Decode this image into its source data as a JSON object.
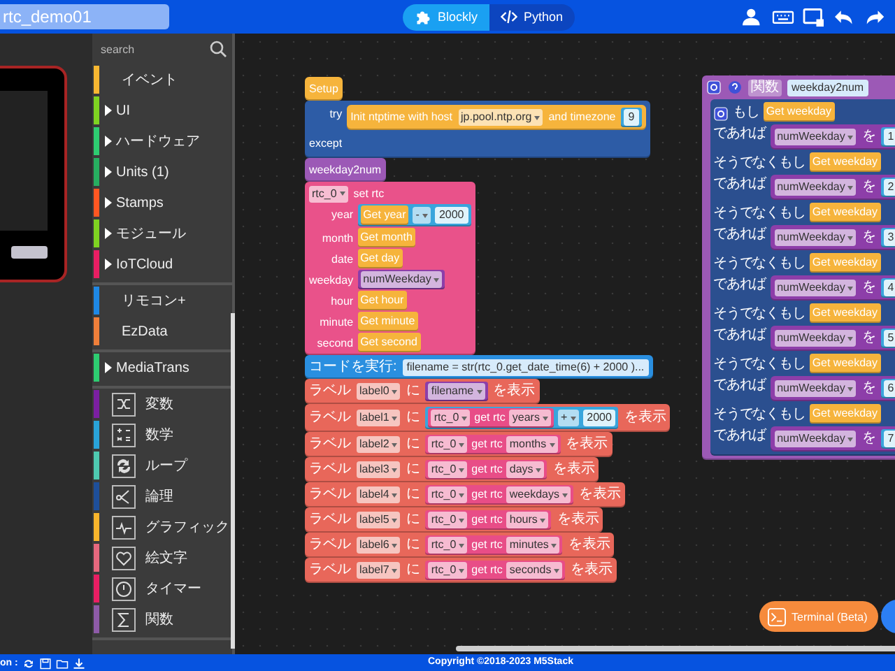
{
  "header": {
    "project_name": "rtc_demo01",
    "tabs": [
      {
        "label": "Blockly",
        "selected": true
      },
      {
        "label": "Python",
        "selected": false
      }
    ]
  },
  "toolbox": {
    "search": {
      "placeholder": "search"
    },
    "groups": [
      {
        "items": [
          {
            "label": "イベント",
            "color": "#f7b731",
            "kind": "plain"
          },
          {
            "label": "UI",
            "color": "#7ed321",
            "kind": "folder"
          },
          {
            "label": "ハードウェア",
            "color": "#2ecc71",
            "kind": "folder"
          },
          {
            "label": "Units (1)",
            "color": "#27ae60",
            "kind": "folder"
          },
          {
            "label": "Stamps",
            "color": "#ff5722",
            "kind": "folder"
          },
          {
            "label": "モジュール",
            "color": "#7ed321",
            "kind": "folder"
          },
          {
            "label": "IoTCloud",
            "color": "#e91e63",
            "kind": "folder"
          }
        ]
      },
      {
        "items": [
          {
            "label": "リモコン+",
            "color": "#1e88e5",
            "kind": "plain"
          },
          {
            "label": "EzData",
            "color": "#ef7f3a",
            "kind": "plain"
          }
        ]
      },
      {
        "items": [
          {
            "label": "MediaTrans",
            "color": "#2ecc71",
            "kind": "folder"
          }
        ]
      },
      {
        "items": [
          {
            "label": "変数",
            "color": "#7b1fa2",
            "kind": "icon"
          },
          {
            "label": "数学",
            "color": "#29a3d9",
            "kind": "icon"
          },
          {
            "label": "ループ",
            "color": "#4ec9b0",
            "kind": "icon"
          },
          {
            "label": "論理",
            "color": "#1e4f9a",
            "kind": "icon"
          },
          {
            "label": "グラフィック",
            "color": "#f9b52c",
            "kind": "icon"
          },
          {
            "label": "絵文字",
            "color": "#e6687e",
            "kind": "icon"
          },
          {
            "label": "タイマー",
            "color": "#e91e63",
            "kind": "icon"
          },
          {
            "label": "関数",
            "color": "#8e5ba8",
            "kind": "icon"
          }
        ]
      }
    ]
  },
  "workspace": {
    "stacks": [
      {
        "blocks": [
          {
            "kind": "statement",
            "color": "#f6b43c",
            "rows": [
              {
                "parts": [
                  {
                    "kind": "text",
                    "text": "Setup"
                  }
                ]
              }
            ]
          },
          {
            "kind": "statement",
            "color": "#2d5ca6",
            "rows": [
              {
                "label": "try",
                "body": [
                  {
                    "kind": "statement",
                    "color": "#f6b43c",
                    "rows": [
                      {
                        "parts": [
                          {
                            "kind": "text",
                            "text": "Init ntptime with host"
                          },
                          {
                            "kind": "dropdown",
                            "text": "jp.pool.ntp.org"
                          },
                          {
                            "kind": "text",
                            "text": "and timezone"
                          },
                          {
                            "kind": "value",
                            "color": "#39a5dc",
                            "parts": [
                              {
                                "kind": "number",
                                "text": "9"
                              }
                            ]
                          }
                        ]
                      }
                    ]
                  }
                ]
              },
              {
                "label": "except",
                "body": []
              }
            ]
          },
          {
            "kind": "statement",
            "color": "#9c59b6",
            "rows": [
              {
                "parts": [
                  {
                    "kind": "text",
                    "text": "weekday2num"
                  }
                ]
              }
            ]
          },
          {
            "kind": "statement",
            "color": "#e9528a",
            "rows": [
              {
                "parts": [
                  {
                    "kind": "dropdown",
                    "text": "rtc_0"
                  },
                  {
                    "kind": "text",
                    "text": "set rtc"
                  }
                ]
              },
              {
                "label": "year",
                "parts": [
                  {
                    "kind": "value",
                    "color": "#39a5dc",
                    "parts": [
                      {
                        "kind": "value",
                        "color": "#f6b43c",
                        "parts": [
                          {
                            "kind": "text",
                            "text": "Get year"
                          }
                        ]
                      },
                      {
                        "kind": "dropdown",
                        "text": "-"
                      },
                      {
                        "kind": "number",
                        "text": "2000"
                      }
                    ]
                  }
                ]
              },
              {
                "label": "month",
                "parts": [
                  {
                    "kind": "value",
                    "color": "#f6b43c",
                    "parts": [
                      {
                        "kind": "text",
                        "text": "Get month"
                      }
                    ]
                  }
                ]
              },
              {
                "label": "date",
                "parts": [
                  {
                    "kind": "value",
                    "color": "#f6b43c",
                    "parts": [
                      {
                        "kind": "text",
                        "text": "Get day"
                      }
                    ]
                  }
                ]
              },
              {
                "label": "weekday",
                "parts": [
                  {
                    "kind": "value",
                    "color": "#8d3ea9",
                    "parts": [
                      {
                        "kind": "dropdown",
                        "text": "numWeekday"
                      }
                    ]
                  }
                ]
              },
              {
                "label": "hour",
                "parts": [
                  {
                    "kind": "value",
                    "color": "#f6b43c",
                    "parts": [
                      {
                        "kind": "text",
                        "text": "Get hour"
                      }
                    ]
                  }
                ]
              },
              {
                "label": "minute",
                "parts": [
                  {
                    "kind": "value",
                    "color": "#f6b43c",
                    "parts": [
                      {
                        "kind": "text",
                        "text": "Get minute"
                      }
                    ]
                  }
                ]
              },
              {
                "label": "second",
                "parts": [
                  {
                    "kind": "value",
                    "color": "#f6b43c",
                    "parts": [
                      {
                        "kind": "text",
                        "text": "Get second"
                      }
                    ]
                  }
                ]
              }
            ]
          },
          {
            "kind": "statement",
            "color": "#2a8fe0",
            "rows": [
              {
                "parts": [
                  {
                    "kind": "text",
                    "text": "コードを実行:"
                  },
                  {
                    "kind": "code",
                    "text": "filename = str(rtc_0.get_date_time(6) + 2000 )..."
                  }
                ]
              }
            ]
          },
          {
            "kind": "statement",
            "color": "#e8675a",
            "rows": [
              {
                "parts": [
                  {
                    "kind": "text",
                    "text": "ラベル"
                  },
                  {
                    "kind": "dropdown",
                    "text": "label0"
                  },
                  {
                    "kind": "text",
                    "text": "に"
                  },
                  {
                    "kind": "value",
                    "color": "#8d3ea9",
                    "parts": [
                      {
                        "kind": "dropdown",
                        "text": "filename"
                      }
                    ]
                  },
                  {
                    "kind": "text",
                    "text": "を表示"
                  }
                ]
              }
            ]
          },
          {
            "kind": "statement",
            "color": "#e8675a",
            "rows": [
              {
                "parts": [
                  {
                    "kind": "text",
                    "text": "ラベル"
                  },
                  {
                    "kind": "dropdown",
                    "text": "label1"
                  },
                  {
                    "kind": "text",
                    "text": "に"
                  },
                  {
                    "kind": "value",
                    "color": "#39a5dc",
                    "parts": [
                      {
                        "kind": "value",
                        "color": "#e84d87",
                        "parts": [
                          {
                            "kind": "dropdown",
                            "text": "rtc_0"
                          },
                          {
                            "kind": "text",
                            "text": "get rtc"
                          },
                          {
                            "kind": "dropdown",
                            "text": "years"
                          }
                        ]
                      },
                      {
                        "kind": "dropdown",
                        "text": "+"
                      },
                      {
                        "kind": "number",
                        "text": "2000"
                      }
                    ]
                  },
                  {
                    "kind": "text",
                    "text": "を表示"
                  }
                ]
              }
            ]
          },
          {
            "kind": "statement",
            "color": "#e8675a",
            "rows": [
              {
                "parts": [
                  {
                    "kind": "text",
                    "text": "ラベル"
                  },
                  {
                    "kind": "dropdown",
                    "text": "label2"
                  },
                  {
                    "kind": "text",
                    "text": "に"
                  },
                  {
                    "kind": "value",
                    "color": "#e84d87",
                    "parts": [
                      {
                        "kind": "dropdown",
                        "text": "rtc_0"
                      },
                      {
                        "kind": "text",
                        "text": "get rtc"
                      },
                      {
                        "kind": "dropdown",
                        "text": "months"
                      }
                    ]
                  },
                  {
                    "kind": "text",
                    "text": "を表示"
                  }
                ]
              }
            ]
          },
          {
            "kind": "statement",
            "color": "#e8675a",
            "rows": [
              {
                "parts": [
                  {
                    "kind": "text",
                    "text": "ラベル"
                  },
                  {
                    "kind": "dropdown",
                    "text": "label3"
                  },
                  {
                    "kind": "text",
                    "text": "に"
                  },
                  {
                    "kind": "value",
                    "color": "#e84d87",
                    "parts": [
                      {
                        "kind": "dropdown",
                        "text": "rtc_0"
                      },
                      {
                        "kind": "text",
                        "text": "get rtc"
                      },
                      {
                        "kind": "dropdown",
                        "text": "days"
                      }
                    ]
                  },
                  {
                    "kind": "text",
                    "text": "を表示"
                  }
                ]
              }
            ]
          },
          {
            "kind": "statement",
            "color": "#e8675a",
            "rows": [
              {
                "parts": [
                  {
                    "kind": "text",
                    "text": "ラベル"
                  },
                  {
                    "kind": "dropdown",
                    "text": "label4"
                  },
                  {
                    "kind": "text",
                    "text": "に"
                  },
                  {
                    "kind": "value",
                    "color": "#e84d87",
                    "parts": [
                      {
                        "kind": "dropdown",
                        "text": "rtc_0"
                      },
                      {
                        "kind": "text",
                        "text": "get rtc"
                      },
                      {
                        "kind": "dropdown",
                        "text": "weekdays"
                      }
                    ]
                  },
                  {
                    "kind": "text",
                    "text": "を表示"
                  }
                ]
              }
            ]
          },
          {
            "kind": "statement",
            "color": "#e8675a",
            "rows": [
              {
                "parts": [
                  {
                    "kind": "text",
                    "text": "ラベル"
                  },
                  {
                    "kind": "dropdown",
                    "text": "label5"
                  },
                  {
                    "kind": "text",
                    "text": "に"
                  },
                  {
                    "kind": "value",
                    "color": "#e84d87",
                    "parts": [
                      {
                        "kind": "dropdown",
                        "text": "rtc_0"
                      },
                      {
                        "kind": "text",
                        "text": "get rtc"
                      },
                      {
                        "kind": "dropdown",
                        "text": "hours"
                      }
                    ]
                  },
                  {
                    "kind": "text",
                    "text": "を表示"
                  }
                ]
              }
            ]
          },
          {
            "kind": "statement",
            "color": "#e8675a",
            "rows": [
              {
                "parts": [
                  {
                    "kind": "text",
                    "text": "ラベル"
                  },
                  {
                    "kind": "dropdown",
                    "text": "label6"
                  },
                  {
                    "kind": "text",
                    "text": "に"
                  },
                  {
                    "kind": "value",
                    "color": "#e84d87",
                    "parts": [
                      {
                        "kind": "dropdown",
                        "text": "rtc_0"
                      },
                      {
                        "kind": "text",
                        "text": "get rtc"
                      },
                      {
                        "kind": "dropdown",
                        "text": "minutes"
                      }
                    ]
                  },
                  {
                    "kind": "text",
                    "text": "を表示"
                  }
                ]
              }
            ]
          },
          {
            "kind": "statement",
            "color": "#e8675a",
            "rows": [
              {
                "parts": [
                  {
                    "kind": "text",
                    "text": "ラベル"
                  },
                  {
                    "kind": "dropdown",
                    "text": "label7"
                  },
                  {
                    "kind": "text",
                    "text": "に"
                  },
                  {
                    "kind": "value",
                    "color": "#e84d87",
                    "parts": [
                      {
                        "kind": "dropdown",
                        "text": "rtc_0"
                      },
                      {
                        "kind": "text",
                        "text": "get rtc"
                      },
                      {
                        "kind": "dropdown",
                        "text": "seconds"
                      }
                    ]
                  },
                  {
                    "kind": "text",
                    "text": "を表示"
                  }
                ]
              }
            ]
          }
        ]
      },
      {
        "blocks": [
          {
            "kind": "function",
            "color": "#9c59b6",
            "rows": [
              {
                "parts": [
                  {
                    "kind": "tag",
                    "text": "関数"
                  },
                  {
                    "kind": "code",
                    "text": "weekday2num"
                  }
                ]
              },
              {
                "body": [
                  {
                    "kind": "if",
                    "color": "#2b4f8f",
                    "rows": [
                      {
                        "label": "もし",
                        "parts": [
                          {
                            "kind": "value",
                            "color": "#f6b43c",
                            "parts": [
                              {
                                "kind": "text",
                                "text": "Get weekday"
                              }
                            ]
                          }
                        ]
                      },
                      {
                        "label": "であれば",
                        "body": [
                          {
                            "kind": "statement",
                            "color": "#8d3ea9",
                            "rows": [
                              {
                                "parts": [
                                  {
                                    "kind": "dropdown",
                                    "text": "numWeekday"
                                  },
                                  {
                                    "kind": "text",
                                    "text": "を"
                                  },
                                  {
                                    "kind": "value",
                                    "color": "#39a5dc",
                                    "parts": [
                                      {
                                        "kind": "number",
                                        "text": "1"
                                      }
                                    ]
                                  }
                                ]
                              }
                            ]
                          }
                        ]
                      },
                      {
                        "label": "そうでなくもし",
                        "parts": [
                          {
                            "kind": "value",
                            "color": "#f6b43c",
                            "parts": [
                              {
                                "kind": "text",
                                "text": "Get weekday"
                              }
                            ]
                          }
                        ]
                      },
                      {
                        "label": "であれば",
                        "body": [
                          {
                            "kind": "statement",
                            "color": "#8d3ea9",
                            "rows": [
                              {
                                "parts": [
                                  {
                                    "kind": "dropdown",
                                    "text": "numWeekday"
                                  },
                                  {
                                    "kind": "text",
                                    "text": "を"
                                  },
                                  {
                                    "kind": "value",
                                    "color": "#39a5dc",
                                    "parts": [
                                      {
                                        "kind": "number",
                                        "text": "2"
                                      }
                                    ]
                                  }
                                ]
                              }
                            ]
                          }
                        ]
                      },
                      {
                        "label": "そうでなくもし",
                        "parts": [
                          {
                            "kind": "value",
                            "color": "#f6b43c",
                            "parts": [
                              {
                                "kind": "text",
                                "text": "Get weekday"
                              }
                            ]
                          }
                        ]
                      },
                      {
                        "label": "であれば",
                        "body": [
                          {
                            "kind": "statement",
                            "color": "#8d3ea9",
                            "rows": [
                              {
                                "parts": [
                                  {
                                    "kind": "dropdown",
                                    "text": "numWeekday"
                                  },
                                  {
                                    "kind": "text",
                                    "text": "を"
                                  },
                                  {
                                    "kind": "value",
                                    "color": "#39a5dc",
                                    "parts": [
                                      {
                                        "kind": "number",
                                        "text": "3"
                                      }
                                    ]
                                  }
                                ]
                              }
                            ]
                          }
                        ]
                      },
                      {
                        "label": "そうでなくもし",
                        "parts": [
                          {
                            "kind": "value",
                            "color": "#f6b43c",
                            "parts": [
                              {
                                "kind": "text",
                                "text": "Get weekday"
                              }
                            ]
                          }
                        ]
                      },
                      {
                        "label": "であれば",
                        "body": [
                          {
                            "kind": "statement",
                            "color": "#8d3ea9",
                            "rows": [
                              {
                                "parts": [
                                  {
                                    "kind": "dropdown",
                                    "text": "numWeekday"
                                  },
                                  {
                                    "kind": "text",
                                    "text": "を"
                                  },
                                  {
                                    "kind": "value",
                                    "color": "#39a5dc",
                                    "parts": [
                                      {
                                        "kind": "number",
                                        "text": "4"
                                      }
                                    ]
                                  }
                                ]
                              }
                            ]
                          }
                        ]
                      },
                      {
                        "label": "そうでなくもし",
                        "parts": [
                          {
                            "kind": "value",
                            "color": "#f6b43c",
                            "parts": [
                              {
                                "kind": "text",
                                "text": "Get weekday"
                              }
                            ]
                          }
                        ]
                      },
                      {
                        "label": "であれば",
                        "body": [
                          {
                            "kind": "statement",
                            "color": "#8d3ea9",
                            "rows": [
                              {
                                "parts": [
                                  {
                                    "kind": "dropdown",
                                    "text": "numWeekday"
                                  },
                                  {
                                    "kind": "text",
                                    "text": "を"
                                  },
                                  {
                                    "kind": "value",
                                    "color": "#39a5dc",
                                    "parts": [
                                      {
                                        "kind": "number",
                                        "text": "5"
                                      }
                                    ]
                                  }
                                ]
                              }
                            ]
                          }
                        ]
                      },
                      {
                        "label": "そうでなくもし",
                        "parts": [
                          {
                            "kind": "value",
                            "color": "#f6b43c",
                            "parts": [
                              {
                                "kind": "text",
                                "text": "Get weekday"
                              }
                            ]
                          }
                        ]
                      },
                      {
                        "label": "であれば",
                        "body": [
                          {
                            "kind": "statement",
                            "color": "#8d3ea9",
                            "rows": [
                              {
                                "parts": [
                                  {
                                    "kind": "dropdown",
                                    "text": "numWeekday"
                                  },
                                  {
                                    "kind": "text",
                                    "text": "を"
                                  },
                                  {
                                    "kind": "value",
                                    "color": "#39a5dc",
                                    "parts": [
                                      {
                                        "kind": "number",
                                        "text": "6"
                                      }
                                    ]
                                  }
                                ]
                              }
                            ]
                          }
                        ]
                      },
                      {
                        "label": "そうでなくもし",
                        "parts": [
                          {
                            "kind": "value",
                            "color": "#f6b43c",
                            "parts": [
                              {
                                "kind": "text",
                                "text": "Get weekday"
                              }
                            ]
                          }
                        ]
                      },
                      {
                        "label": "であれば",
                        "body": [
                          {
                            "kind": "statement",
                            "color": "#8d3ea9",
                            "rows": [
                              {
                                "parts": [
                                  {
                                    "kind": "dropdown",
                                    "text": "numWeekday"
                                  },
                                  {
                                    "kind": "text",
                                    "text": "を"
                                  },
                                  {
                                    "kind": "value",
                                    "color": "#39a5dc",
                                    "parts": [
                                      {
                                        "kind": "number",
                                        "text": "7"
                                      }
                                    ]
                                  }
                                ]
                              }
                            ]
                          }
                        ]
                      }
                    ]
                  }
                ]
              }
            ]
          }
        ]
      }
    ],
    "terminal_button": "Terminal (Beta)"
  },
  "status_bar": {
    "left_text": "on :",
    "copyright": "Copyright ©2018-2023 M5Stack"
  }
}
